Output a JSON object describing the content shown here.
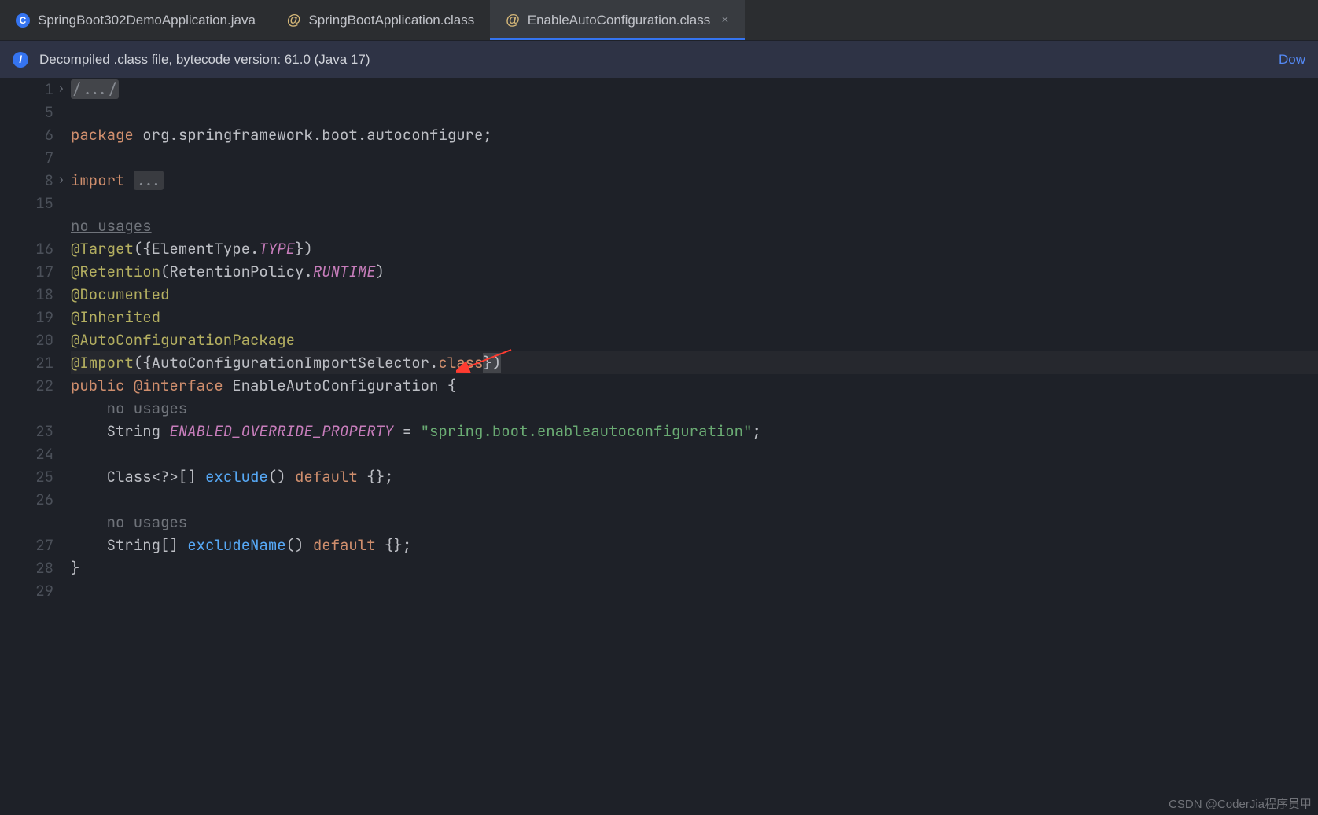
{
  "tabs": [
    {
      "label": "SpringBoot302DemoApplication.java",
      "icon": "c",
      "active": false
    },
    {
      "label": "SpringBootApplication.class",
      "icon": "at",
      "active": false
    },
    {
      "label": "EnableAutoConfiguration.class",
      "icon": "at",
      "active": true
    }
  ],
  "info_bar": {
    "text": "Decompiled .class file, bytecode version: 61.0 (Java 17)",
    "link": "Dow"
  },
  "gutter": [
    "1",
    "5",
    "6",
    "7",
    "8",
    "15",
    "",
    "16",
    "17",
    "18",
    "19",
    "20",
    "21",
    "22",
    "",
    "23",
    "24",
    "25",
    "26",
    "",
    "27",
    "28",
    "29"
  ],
  "fold_rows": [
    0,
    4
  ],
  "code": {
    "l1_folded": "/.../",
    "l6_kw": "package",
    "l6_pkg": " org.springframework.boot.autoconfigure;",
    "l8_kw": "import",
    "l8_fold": "...",
    "l_usages": "no usages",
    "l16_a": "@Target",
    "l16_b": "({ElementType.",
    "l16_c": "TYPE",
    "l16_d": "})",
    "l17_a": "@Retention",
    "l17_b": "(RetentionPolicy.",
    "l17_c": "RUNTIME",
    "l17_d": ")",
    "l18": "@Documented",
    "l19": "@Inherited",
    "l20": "@AutoConfigurationPackage",
    "l21_a": "@Import",
    "l21_b": "({AutoConfigurationImportSelector.",
    "l21_c": "class",
    "l21_d": "})",
    "l22_a": "public ",
    "l22_b": "@interface ",
    "l22_c": "EnableAutoConfiguration {",
    "l_hint2": "no usages",
    "l23_a": "String ",
    "l23_b": "ENABLED_OVERRIDE_PROPERTY",
    "l23_c": " = ",
    "l23_d": "\"spring.boot.enableautoconfiguration\"",
    "l23_e": ";",
    "l25_a": "Class<?>[] ",
    "l25_b": "exclude",
    "l25_c": "() ",
    "l25_d": "default ",
    "l25_e": "{};",
    "l_hint3": "no usages",
    "l27_a": "String[] ",
    "l27_b": "excludeName",
    "l27_c": "() ",
    "l27_d": "default ",
    "l27_e": "{};",
    "l28": "}"
  },
  "watermark": "CSDN @CoderJia程序员甲"
}
